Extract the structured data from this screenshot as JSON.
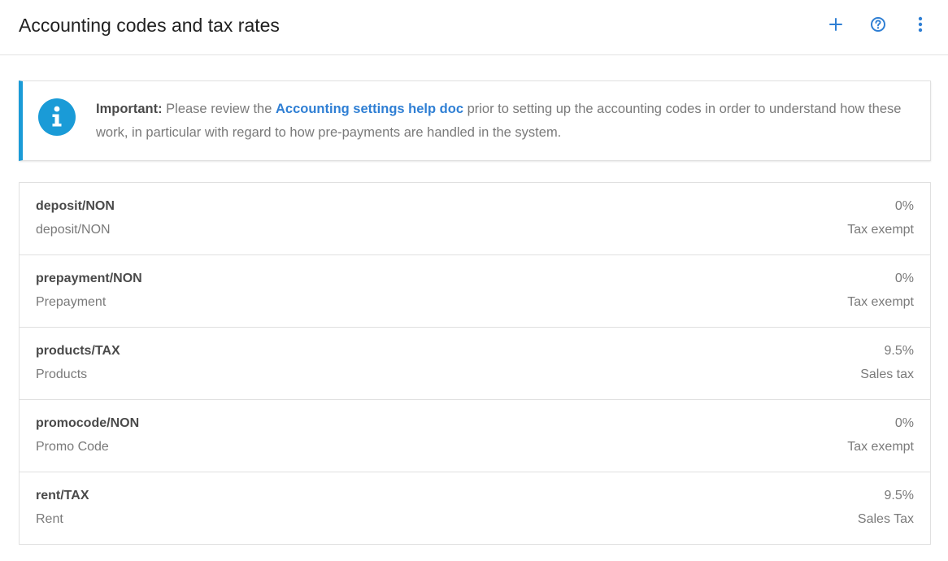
{
  "header": {
    "title": "Accounting codes and tax rates",
    "icons": {
      "add": "plus-icon",
      "help": "help-circle-icon",
      "more": "more-vertical-icon"
    },
    "accent_color": "#2f7fd4"
  },
  "info": {
    "icon": "info-icon",
    "important_label": "Important:",
    "text_before_link": " Please review the ",
    "link_text": "Accounting settings help doc",
    "text_after_link": " prior to setting up the accounting codes in order to understand how these work, in particular with regard to how pre-payments are handled in the system.",
    "border_color": "#1a9bd7"
  },
  "codes": [
    {
      "name": "deposit/NON",
      "description": "deposit/NON",
      "rate": "0%",
      "tax_type": "Tax exempt"
    },
    {
      "name": "prepayment/NON",
      "description": "Prepayment",
      "rate": "0%",
      "tax_type": "Tax exempt"
    },
    {
      "name": "products/TAX",
      "description": "Products",
      "rate": "9.5%",
      "tax_type": "Sales tax"
    },
    {
      "name": "promocode/NON",
      "description": "Promo Code",
      "rate": "0%",
      "tax_type": "Tax exempt"
    },
    {
      "name": "rent/TAX",
      "description": "Rent",
      "rate": "9.5%",
      "tax_type": "Sales Tax"
    }
  ]
}
